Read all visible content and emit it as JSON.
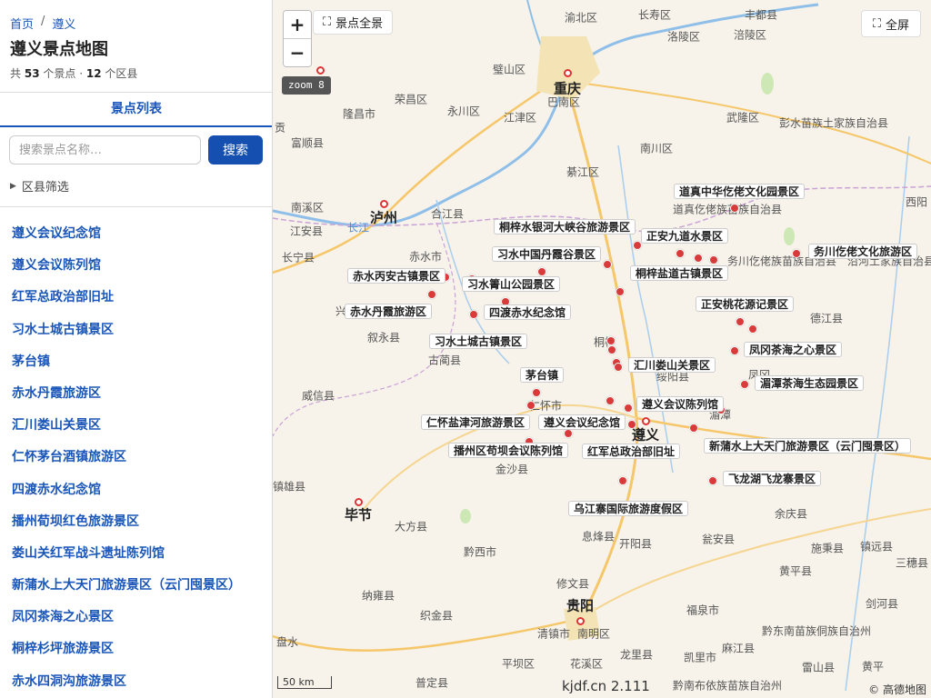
{
  "breadcrumb": {
    "home": "首页",
    "sep": "/",
    "city": "遵义"
  },
  "title": "遵义景点地图",
  "stats": {
    "prefix": "共",
    "spots": "53",
    "spots_unit": "个景点 ·",
    "districts": "12",
    "districts_unit": "个区县"
  },
  "tab_label": "景点列表",
  "search": {
    "placeholder": "搜索景点名称…",
    "button": "搜索"
  },
  "filter_label": "区县筛选",
  "spots": [
    "遵义会议纪念馆",
    "遵义会议陈列馆",
    "红军总政治部旧址",
    "习水土城古镇景区",
    "茅台镇",
    "赤水丹霞旅游区",
    "汇川娄山关景区",
    "仁怀茅台酒镇旅游区",
    "四渡赤水纪念馆",
    "播州荀坝红色旅游景区",
    "娄山关红军战斗遗址陈列馆",
    "新蒲水上大天门旅游景区（云门囤景区）",
    "凤冈茶海之心景区",
    "桐梓杉坪旅游景区",
    "赤水四洞沟旅游景区"
  ],
  "map": {
    "zoom_in": "+",
    "zoom_out": "−",
    "overview_button": "景点全景",
    "fullscreen_button": "全屏",
    "zoom_badge": "zoom 8",
    "scale": "50 km",
    "attribution": "© 高德地图",
    "watermark": "kjdf.cn 2.111",
    "colors": {
      "marker": "#d93a3a",
      "accent": "#1550b0"
    },
    "icons": {
      "expand": "expand-icon",
      "filter": "triangle-right-icon"
    },
    "places": [
      {
        "t": "重庆",
        "k": "city"
      },
      {
        "t": "遵义",
        "k": "city"
      },
      {
        "t": "贵阳",
        "k": "city"
      },
      {
        "t": "泸州",
        "k": "city"
      },
      {
        "t": "毕节",
        "k": "city"
      },
      {
        "t": "綦江区"
      },
      {
        "t": "江津区"
      },
      {
        "t": "璧山区"
      },
      {
        "t": "永川区"
      },
      {
        "t": "荣昌区"
      },
      {
        "t": "隆昌市"
      },
      {
        "t": "巴南区"
      },
      {
        "t": "南川区"
      },
      {
        "t": "武隆区"
      },
      {
        "t": "涪陵区"
      },
      {
        "t": "长寿区"
      },
      {
        "t": "合江县"
      },
      {
        "t": "赤水市"
      },
      {
        "t": "叙永县"
      },
      {
        "t": "古蔺县"
      },
      {
        "t": "威信县"
      },
      {
        "t": "金沙县"
      },
      {
        "t": "大方县"
      },
      {
        "t": "黔西市"
      },
      {
        "t": "织金县"
      },
      {
        "t": "纳雍县"
      },
      {
        "t": "息烽县"
      },
      {
        "t": "开阳县"
      },
      {
        "t": "修文县"
      },
      {
        "t": "清镇市"
      },
      {
        "t": "龙里县"
      },
      {
        "t": "福泉市"
      },
      {
        "t": "瓮安县"
      },
      {
        "t": "余庆县"
      },
      {
        "t": "施秉县"
      },
      {
        "t": "黄平县"
      },
      {
        "t": "镇远县"
      },
      {
        "t": "三穗县"
      },
      {
        "t": "剑河县"
      },
      {
        "t": "麻江县"
      },
      {
        "t": "凯里市"
      },
      {
        "t": "德江县"
      },
      {
        "t": "道真仡佬族苗族自治县"
      },
      {
        "t": "彭水苗族土家族自治县"
      },
      {
        "t": "务川仡佬族苗族自治县"
      },
      {
        "t": "沿河土家族自治县"
      },
      {
        "t": "黔东南苗族侗族自治州"
      },
      {
        "t": "黔南布依族苗族自治州"
      },
      {
        "t": "渝北区"
      },
      {
        "t": "富顺县"
      },
      {
        "t": "江安县"
      },
      {
        "t": "长宁县"
      },
      {
        "t": "镇雄县"
      },
      {
        "t": "南溪区"
      },
      {
        "t": "盘水"
      },
      {
        "t": "兴"
      },
      {
        "t": "贡"
      },
      {
        "t": "平坝区"
      },
      {
        "t": "花溪区"
      },
      {
        "t": "南明区"
      },
      {
        "t": "普定县"
      },
      {
        "t": "雷山县"
      },
      {
        "t": "黄平"
      },
      {
        "t": "绥阳县"
      },
      {
        "t": "桐梓"
      },
      {
        "t": "凤冈"
      },
      {
        "t": "湄潭"
      },
      {
        "t": "仁怀市"
      },
      {
        "t": "长江",
        "k": "river"
      },
      {
        "t": "西阳"
      },
      {
        "t": "丰都县"
      },
      {
        "t": "洛陵区"
      }
    ],
    "attractions": [
      "道真中华仡佬文化园景区",
      "桐梓水银河大峡谷旅游景区",
      "正安九道水景区",
      "习水中国丹霞谷景区",
      "务川仡佬文化旅游区",
      "赤水丙安古镇景区",
      "桐梓盐道古镇景区",
      "习水箐山公园景区",
      "正安桃花源记景区",
      "赤水丹霞旅游区",
      "四渡赤水纪念馆",
      "习水土城古镇景区",
      "凤冈茶海之心景区",
      "汇川娄山关景区",
      "茅台镇",
      "湄潭茶海生态园景区",
      "遵义会议陈列馆",
      "仁怀盐津河旅游景区",
      "遵义会议纪念馆",
      "播州区苟坝会议陈列馆",
      "红军总政治部旧址",
      "新蒲水上大天门旅游景区（云门囤景区）",
      "飞龙湖飞龙寨景区",
      "乌江寨国际旅游度假区"
    ]
  }
}
